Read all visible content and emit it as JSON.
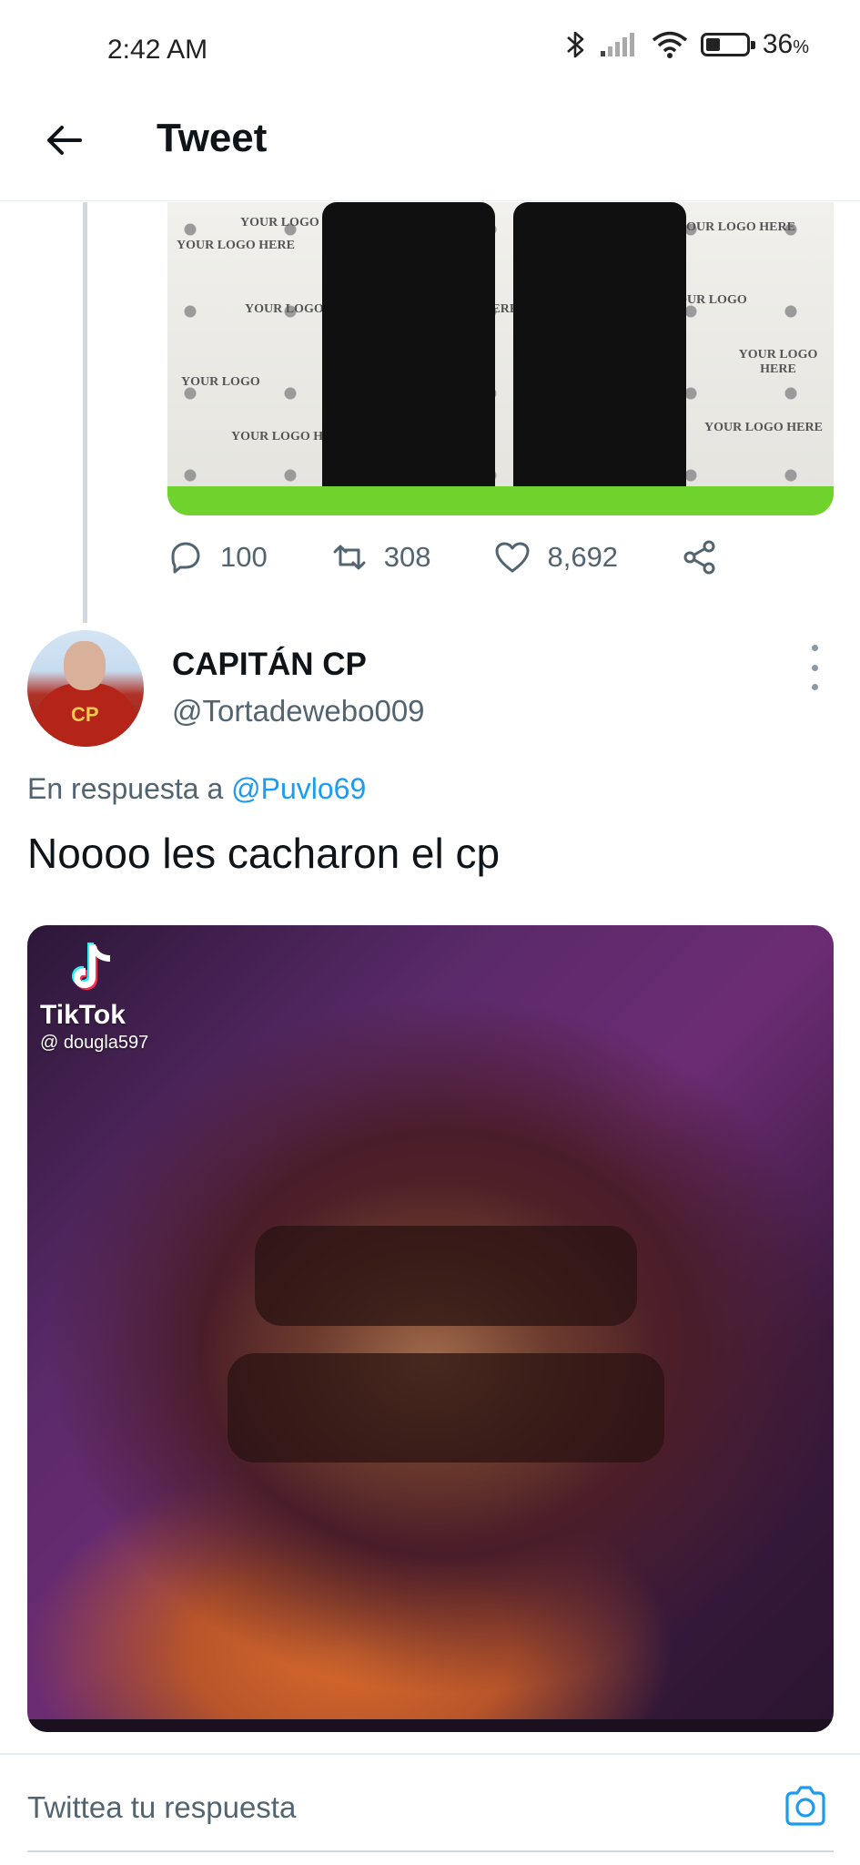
{
  "status_bar": {
    "time": "2:42 AM",
    "battery_percent": "36",
    "battery_suffix": "%",
    "battery_level": 0.36,
    "icons": [
      "bluetooth-icon",
      "signal-icon",
      "wifi-icon",
      "battery-icon"
    ]
  },
  "header": {
    "back_icon": "arrow-left-icon",
    "title": "Tweet"
  },
  "previous_tweet": {
    "actions": {
      "replies": "100",
      "retweets": "308",
      "likes": "8,692"
    },
    "backdrop_text": [
      "YOUR LOGO HERE",
      "YOUR LOGO",
      "LOGO HERE"
    ]
  },
  "reply": {
    "display_name": "CAPITÁN CP",
    "handle": "@Tortadewebo009",
    "avatar_text": "CP",
    "reply_prefix": "En respuesta a",
    "reply_to": "@Puvlo69",
    "text": "Noooo les cacharon el cp",
    "video": {
      "watermark_brand": "TikTok",
      "watermark_user": "@ dougla597"
    }
  },
  "compose": {
    "placeholder": "Twittea tu respuesta",
    "camera_icon": "camera-icon"
  },
  "colors": {
    "accent": "#1d9bf0",
    "secondary_text": "#536471",
    "primary_text": "#0f1419"
  }
}
